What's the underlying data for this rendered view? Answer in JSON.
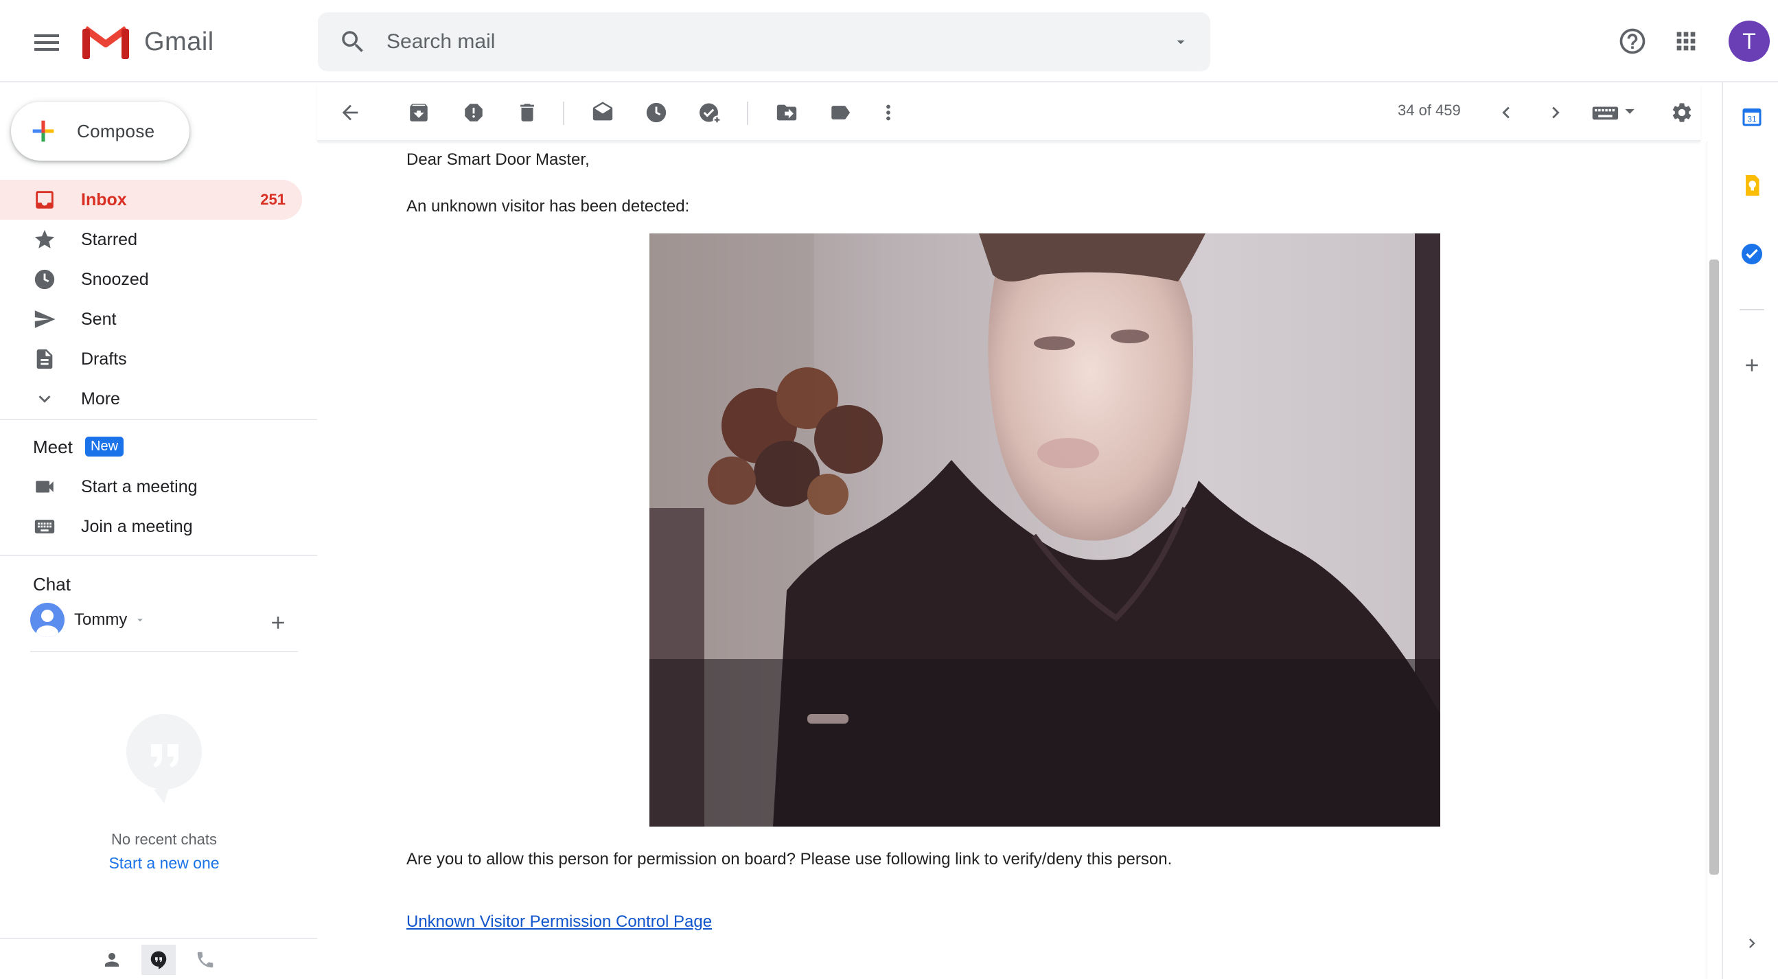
{
  "app": {
    "name": "Gmail",
    "avatar_initial": "T",
    "brand_red": "#EA4335",
    "accent_blue": "#1A73E8"
  },
  "search": {
    "placeholder": "Search mail"
  },
  "compose": {
    "label": "Compose"
  },
  "nav": {
    "items": [
      {
        "label": "Inbox",
        "count": "251",
        "icon": "inbox-icon",
        "active": true
      },
      {
        "label": "Starred",
        "count": "",
        "icon": "star-icon"
      },
      {
        "label": "Snoozed",
        "count": "",
        "icon": "clock-icon"
      },
      {
        "label": "Sent",
        "count": "",
        "icon": "send-icon"
      },
      {
        "label": "Drafts",
        "count": "",
        "icon": "draft-icon"
      },
      {
        "label": "More",
        "count": "",
        "icon": "chevron-down-icon"
      }
    ]
  },
  "meet": {
    "title": "Meet",
    "badge": "New",
    "start": "Start a meeting",
    "join": "Join a meeting"
  },
  "chat": {
    "title": "Chat",
    "user": "Tommy",
    "no_recent": "No recent chats",
    "start_new": "Start a new one"
  },
  "toolbar": {
    "pager": "34 of 459"
  },
  "message": {
    "greeting": "Dear Smart Door Master,",
    "intro": "An unknown visitor has been detected:",
    "question": "Are you to allow this person for permission on board? Please use following link to verify/deny this person.",
    "link_text": "Unknown Visitor Permission Control Page"
  }
}
